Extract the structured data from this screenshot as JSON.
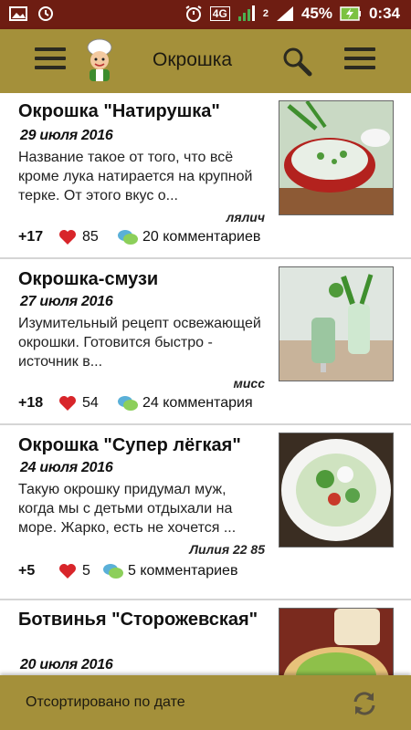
{
  "status_bar": {
    "network": "4G",
    "signal_sim": "2",
    "battery_percent": "45%",
    "time": "0:34"
  },
  "app_bar": {
    "title": "Окрошка"
  },
  "recipes": [
    {
      "title": "Окрошка \"Натирушка\"",
      "date": "29 июля 2016",
      "description": "Название такое от того, что всё кроме лука натирается на крупной терке. От этого вкус о...",
      "author": "лялич",
      "votes": "+17",
      "likes": "85",
      "comments": "20 комментариев"
    },
    {
      "title": "Окрошка-смузи",
      "date": "27 июля 2016",
      "description": "Изумительный рецепт освежающей окрошки. Готовится быстро - источник в...",
      "author": "мисс",
      "votes": "+18",
      "likes": "54",
      "comments": "24 комментария"
    },
    {
      "title": "Окрошка \"Супер лёгкая\"",
      "date": "24 июля 2016",
      "description": "Такую окрошку придумал муж, когда мы с детьми отдыхали на море. Жарко, есть не хочется ...",
      "author": "Лилия 22 85",
      "votes": "+5",
      "likes": "5",
      "comments": "5 комментариев"
    },
    {
      "title": "Ботвинья \"Сторожевская\"",
      "date": "20 июля 2016",
      "description": "",
      "author": "",
      "votes": "",
      "likes": "",
      "comments": ""
    }
  ],
  "bottom_bar": {
    "sort_label": "Отсортировано по дате"
  },
  "icons": {
    "menu": "hamburger-icon",
    "logo": "chef-logo-icon",
    "search": "search-icon",
    "overflow": "overflow-menu-icon",
    "heart": "heart-icon",
    "comments": "comment-bubbles-icon",
    "refresh": "refresh-icon"
  },
  "colors": {
    "status_bar": "#6e1d12",
    "app_bar": "#a4903a",
    "heart": "#d8252a"
  }
}
